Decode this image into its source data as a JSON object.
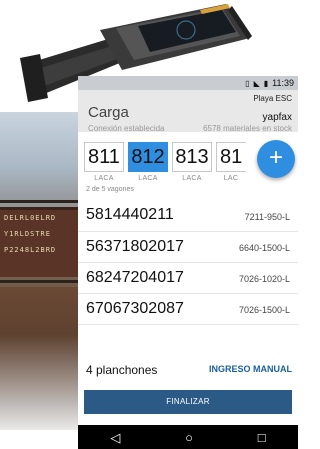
{
  "status_bar": {
    "time": "11:39",
    "icons": [
      "vibrate-icon",
      "signal-icon",
      "battery-icon"
    ]
  },
  "header": {
    "title": "Carga",
    "location": "Playa ESC",
    "user": "yapfax",
    "connection": "Conexión establecida",
    "stock": "6578 materiales en stock"
  },
  "wagons": {
    "items": [
      {
        "number": "811",
        "label": "LACA",
        "selected": false
      },
      {
        "number": "812",
        "label": "LACA",
        "selected": true
      },
      {
        "number": "813",
        "label": "LACA",
        "selected": false
      },
      {
        "number": "81",
        "label": "LAC",
        "selected": false
      }
    ],
    "count_text": "2 de 5 vagones",
    "add_label": "+"
  },
  "materials": [
    {
      "code": "5814440211",
      "ref": "7211-950-L"
    },
    {
      "code": "56371802017",
      "ref": "6640-1500-L"
    },
    {
      "code": "68247204017",
      "ref": "7026-1020-L"
    },
    {
      "code": "67067302087",
      "ref": "7026-1500-L"
    }
  ],
  "footer": {
    "count": "4 planchones",
    "manual_entry": "INGRESO MANUAL",
    "finish": "FINALIZAR"
  },
  "colors": {
    "accent": "#2f8ee0",
    "button": "#2b5a86",
    "link": "#1a5f9e"
  }
}
